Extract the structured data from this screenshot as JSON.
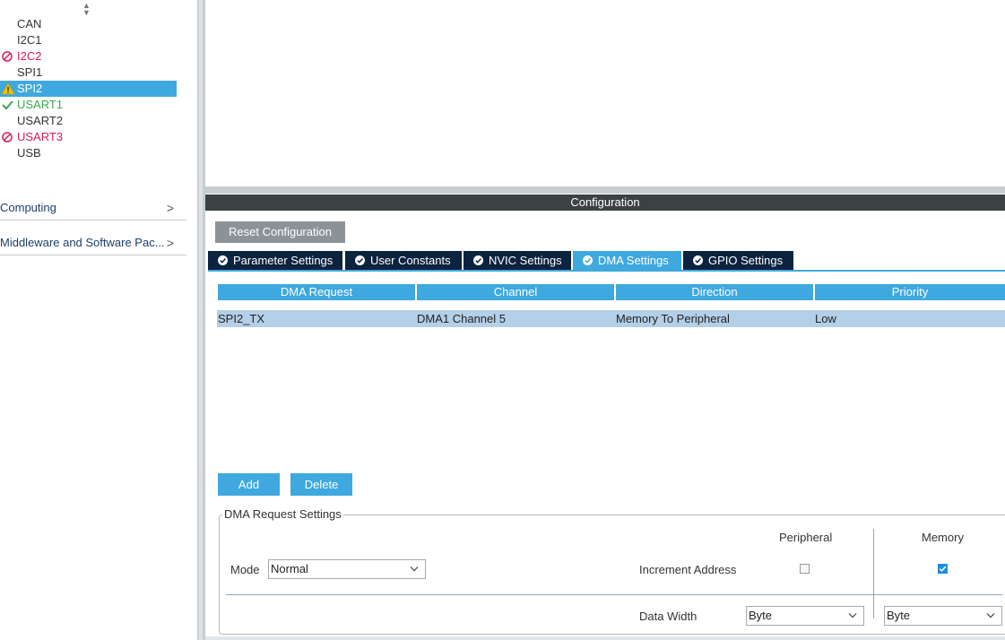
{
  "sidebar": {
    "peripherals": [
      {
        "label": "CAN",
        "status": "none"
      },
      {
        "label": "I2C1",
        "status": "none"
      },
      {
        "label": "I2C2",
        "status": "conflict"
      },
      {
        "label": "SPI1",
        "status": "none"
      },
      {
        "label": "SPI2",
        "status": "warning",
        "selected": true
      },
      {
        "label": "USART1",
        "status": "ok"
      },
      {
        "label": "USART2",
        "status": "none"
      },
      {
        "label": "USART3",
        "status": "conflict"
      },
      {
        "label": "USB",
        "status": "none"
      }
    ],
    "categories": [
      {
        "label": "Computing",
        "icon": "chevron-right-icon"
      },
      {
        "label": "Middleware and Software Pac...",
        "icon": "chevron-right-icon"
      }
    ]
  },
  "config": {
    "header": "Configuration",
    "reset_button": "Reset Configuration",
    "tabs": [
      {
        "label": "Parameter Settings",
        "active": false
      },
      {
        "label": "User Constants",
        "active": false
      },
      {
        "label": "NVIC Settings",
        "active": false
      },
      {
        "label": "DMA Settings",
        "active": true
      },
      {
        "label": "GPIO Settings",
        "active": false
      }
    ]
  },
  "dma_table": {
    "columns": [
      "DMA Request",
      "Channel",
      "Direction",
      "Priority"
    ],
    "rows": [
      [
        "SPI2_TX",
        "DMA1 Channel 5",
        "Memory To Peripheral",
        "Low"
      ]
    ]
  },
  "buttons": {
    "add": "Add",
    "delete": "Delete"
  },
  "dma_request_settings": {
    "title": "DMA Request Settings",
    "mode_label": "Mode",
    "mode_value": "Normal",
    "peripheral_header": "Peripheral",
    "memory_header": "Memory",
    "increment_label": "Increment Address",
    "peripheral_increment": false,
    "memory_increment": true,
    "data_width_label": "Data Width",
    "peripheral_width": "Byte",
    "memory_width": "Byte"
  },
  "colors": {
    "accent": "#3fa8df",
    "tab_dark": "#0c2340",
    "error": "#d81b60",
    "ok": "#3aa64e",
    "warning": "#f2c200"
  }
}
